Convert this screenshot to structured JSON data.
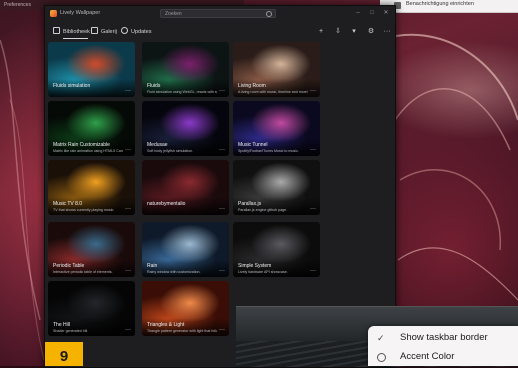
{
  "top_strip": {
    "title": "Preferences"
  },
  "top_right_panel": {
    "label": "Benachrichtigung einrichten"
  },
  "window": {
    "app_title": "Lively Wallpaper",
    "search_placeholder": "Zoeken",
    "controls": {
      "minimize": "–",
      "maximize": "□",
      "close": "✕"
    }
  },
  "nav": {
    "library": "Bibliotheek",
    "gallery": "Galerij",
    "updates": "Updates"
  },
  "toolbar_icons": [
    "add-icon",
    "download-icon",
    "filter-icon",
    "settings-icon",
    "more-icon"
  ],
  "tiles": [
    {
      "title": "Fluids simulation",
      "desc": "",
      "colors": [
        "#0b3a4a",
        "#1e8fa8",
        "#d04a2a"
      ]
    },
    {
      "title": "Fluids",
      "desc": "Fluid simulation using WebGL, reacts with system audio & cursor.",
      "colors": [
        "#0c1414",
        "#1f6e4a",
        "#7a1f6a"
      ]
    },
    {
      "title": "Living Room",
      "desc": "A living room with music, timeline and more!",
      "colors": [
        "#2a1c18",
        "#8a5a46",
        "#d4b39a"
      ]
    },
    {
      "title": "Matrix Rain Customizable",
      "desc": "Matrix like rain animation using HTML5 Canvas.",
      "colors": [
        "#050a06",
        "#0c3a16",
        "#2fa04a"
      ]
    },
    {
      "title": "Medusae",
      "desc": "Soft body jellyfish simulation.",
      "colors": [
        "#05060d",
        "#1a1f3a",
        "#8a3ac8"
      ]
    },
    {
      "title": "Music Tunnel",
      "desc": "Spotify/Foobar/iTunes Music to music.",
      "colors": [
        "#0b0920",
        "#2e2a8a",
        "#c04aa0"
      ]
    },
    {
      "title": "Music TV 8.0",
      "desc": "TV that shows currently playing music.",
      "colors": [
        "#1a1008",
        "#8a5a10",
        "#f0a020"
      ]
    },
    {
      "title": "naturebymentalio",
      "desc": "",
      "colors": [
        "#1a0a0c",
        "#5a1a20",
        "#8a2a30"
      ]
    },
    {
      "title": "Parallax.js",
      "desc": "Parallax.js engine github page.",
      "colors": [
        "#101010",
        "#3a3a3a",
        "#aaaaaa"
      ]
    },
    {
      "title": "Periodic Table",
      "desc": "Interactive periodic table of elements.",
      "colors": [
        "#1a0a0a",
        "#8a2a2a",
        "#3a6a8a"
      ]
    },
    {
      "title": "Rain",
      "desc": "Rainy window with customization.",
      "colors": [
        "#0e1a2a",
        "#3a6a9a",
        "#9ab8d0"
      ]
    },
    {
      "title": "Simple System",
      "desc": "Lively hardware API showcase.",
      "colors": [
        "#0c0c0c",
        "#2a2a2c",
        "#5a5a60"
      ]
    },
    {
      "title": "The Hill",
      "desc": "Shader generated hill.",
      "colors": [
        "#050505",
        "#121416",
        "#22262a"
      ]
    },
    {
      "title": "Triangles & Light",
      "desc": "Triangle pattern generator with light that follows cursor.",
      "colors": [
        "#3a0e06",
        "#c0461a",
        "#f08a4a"
      ]
    }
  ],
  "context_menu": {
    "items": [
      {
        "label": "Show taskbar border",
        "kind": "check"
      },
      {
        "label": "Accent Color",
        "kind": "radio"
      }
    ]
  },
  "step_badge": {
    "number": "9",
    "color": "#f5b300"
  }
}
